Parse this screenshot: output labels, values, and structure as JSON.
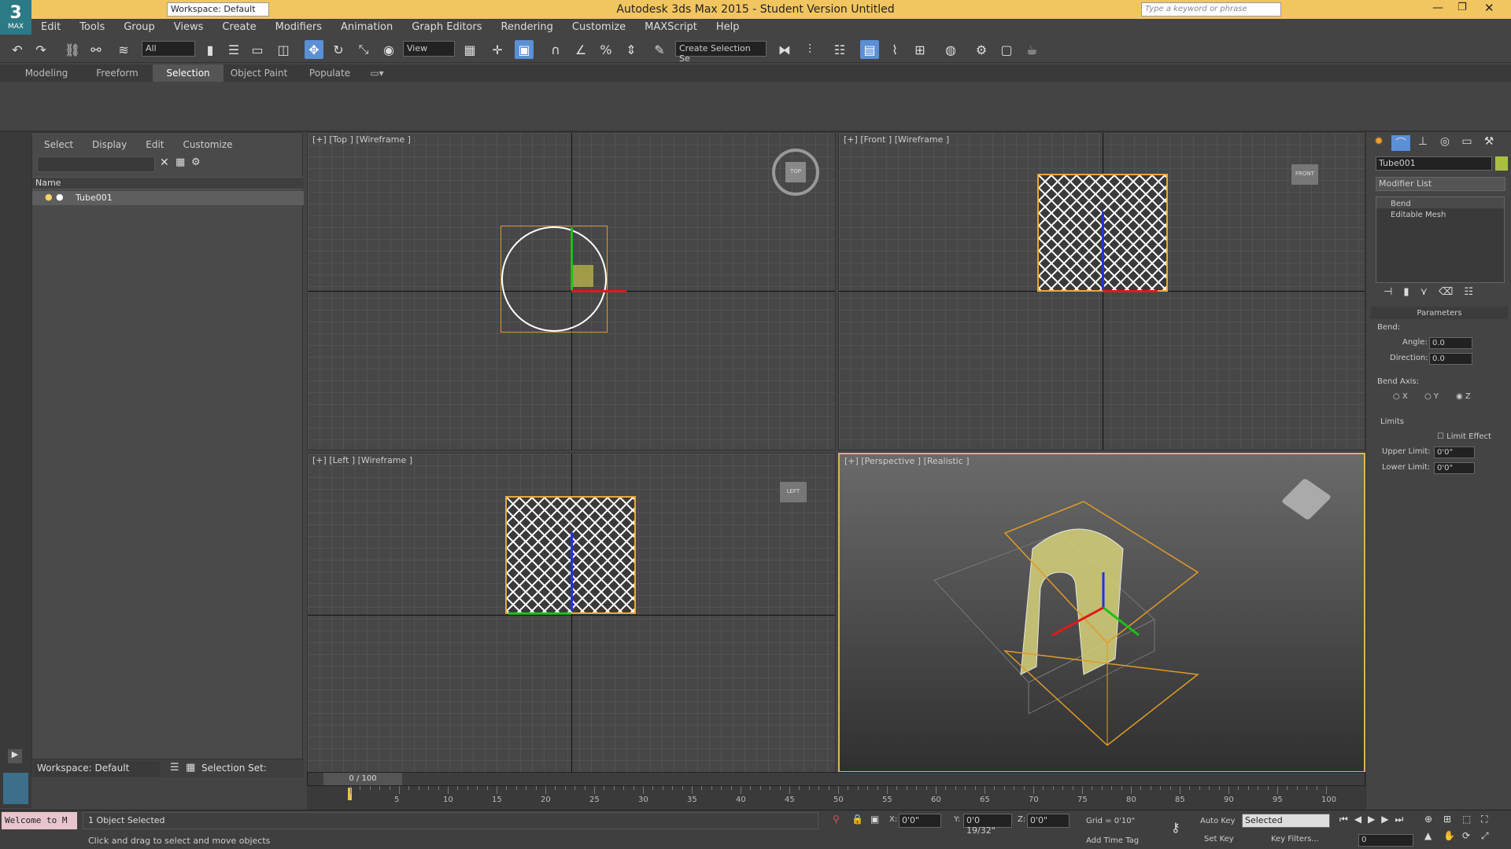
{
  "app": {
    "title": "Autodesk 3ds Max 2015   - Student Version   Untitled",
    "logo": "MAX",
    "workspace": "Workspace: Default",
    "search_placeholder": "Type a keyword or phrase"
  },
  "menu": [
    "Edit",
    "Tools",
    "Group",
    "Views",
    "Create",
    "Modifiers",
    "Animation",
    "Graph Editors",
    "Rendering",
    "Customize",
    "MAXScript",
    "Help"
  ],
  "toolbar": {
    "filter": "All",
    "refcoord": "View",
    "selset": "Create Selection Se"
  },
  "ribbon": {
    "tabs": [
      "Modeling",
      "Freeform",
      "Selection",
      "Object Paint",
      "Populate"
    ],
    "active": "Selection"
  },
  "scene": {
    "tabs": [
      "Select",
      "Display",
      "Edit",
      "Customize"
    ],
    "column": "Name",
    "items": [
      "Tube001"
    ],
    "workspace": "Workspace: Default",
    "selection_set": "Selection Set:"
  },
  "viewports": {
    "top": "[+] [Top ] [Wireframe ]",
    "front": "[+] [Front ] [Wireframe ]",
    "left": "[+] [Left ] [Wireframe ]",
    "persp": "[+] [Perspective ] [Realistic ]",
    "cube_top": "TOP",
    "cube_front": "FRONT",
    "cube_left": "LEFT"
  },
  "command": {
    "object_name": "Tube001",
    "object_color": "#a8c040",
    "modifier_list": "Modifier List",
    "stack": [
      "Bend",
      "Editable Mesh"
    ],
    "params_title": "Parameters",
    "bend_label": "Bend:",
    "angle_label": "Angle:",
    "angle": "0.0",
    "direction_label": "Direction:",
    "direction": "0.0",
    "bend_axis": "Bend Axis:",
    "axis_x": "X",
    "axis_y": "Y",
    "axis_z": "Z",
    "limits": "Limits",
    "limit_effect": "Limit Effect",
    "upper_label": "Upper Limit:",
    "upper": "0'0\"",
    "lower_label": "Lower Limit:",
    "lower": "0'0\""
  },
  "timeline": {
    "frame": "0 / 100",
    "ticks": [
      "5",
      "10",
      "15",
      "20",
      "25",
      "30",
      "35",
      "40",
      "45",
      "50",
      "55",
      "60",
      "65",
      "70",
      "75",
      "80",
      "85",
      "90",
      "95",
      "100"
    ]
  },
  "status": {
    "maxscript": "Welcome to M",
    "selected": "1 Object Selected",
    "prompt": "Click and drag to select and move objects",
    "x_label": "X:",
    "x": "0'0\"",
    "y_label": "Y:",
    "y": "0'0 19/32\"",
    "z_label": "Z:",
    "z": "0'0\"",
    "grid": "Grid = 0'10\"",
    "add_time_tag": "Add Time Tag",
    "auto_key": "Auto Key",
    "set_key": "Set Key",
    "key_mode": "Selected",
    "key_filters": "Key Filters...",
    "frame_field": "0"
  },
  "colors": {
    "title_bg": "#f1c560",
    "accent": "#5b8fd6",
    "selection": "#e2b25a"
  }
}
